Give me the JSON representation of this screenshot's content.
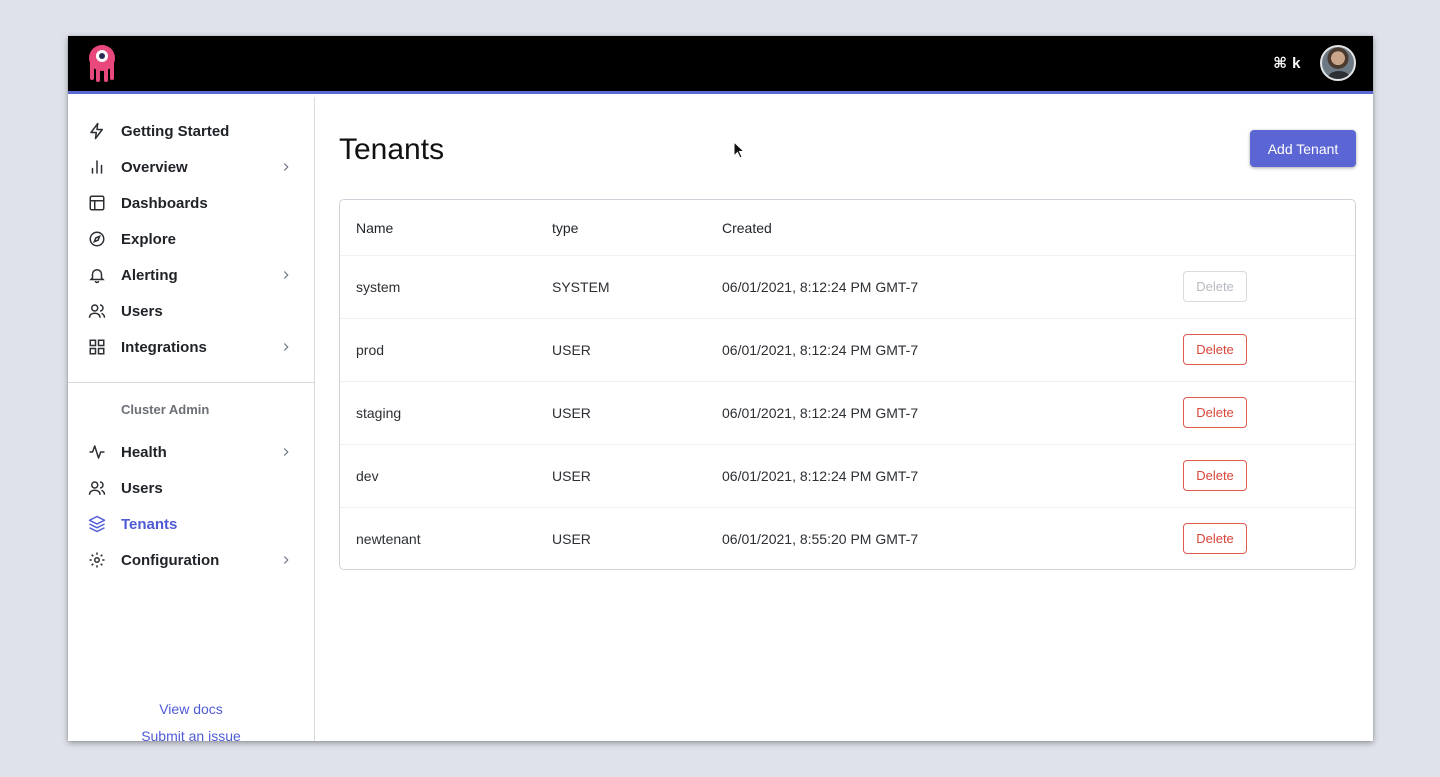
{
  "topbar": {
    "shortcut": "⌘ k",
    "accent_color": "#5b6ad3",
    "logo_icon": "octopus-logo-icon",
    "avatar_icon": "user-avatar"
  },
  "sidebar": {
    "items": [
      {
        "label": "Getting Started",
        "icon": "bolt-icon",
        "chevron": false
      },
      {
        "label": "Overview",
        "icon": "bar-chart-icon",
        "chevron": true
      },
      {
        "label": "Dashboards",
        "icon": "dashboard-icon",
        "chevron": false
      },
      {
        "label": "Explore",
        "icon": "compass-icon",
        "chevron": false
      },
      {
        "label": "Alerting",
        "icon": "bell-icon",
        "chevron": true
      },
      {
        "label": "Users",
        "icon": "users-icon",
        "chevron": false
      },
      {
        "label": "Integrations",
        "icon": "grid-icon",
        "chevron": true
      }
    ],
    "section_title": "Cluster Admin",
    "admin_items": [
      {
        "label": "Health",
        "icon": "activity-icon",
        "chevron": true
      },
      {
        "label": "Users",
        "icon": "users-icon",
        "chevron": false
      },
      {
        "label": "Tenants",
        "icon": "layers-icon",
        "chevron": false,
        "active": true
      },
      {
        "label": "Configuration",
        "icon": "gear-icon",
        "chevron": true
      }
    ],
    "links": {
      "docs": "View docs",
      "issue": "Submit an issue"
    },
    "active_color": "#4f5bd5"
  },
  "main": {
    "title": "Tenants",
    "add_button": "Add Tenant",
    "table": {
      "headers": [
        "Name",
        "type",
        "Created"
      ],
      "rows": [
        {
          "name": "system",
          "type": "SYSTEM",
          "created": "06/01/2021, 8:12:24 PM GMT-7",
          "action": "Delete",
          "disabled": true
        },
        {
          "name": "prod",
          "type": "USER",
          "created": "06/01/2021, 8:12:24 PM GMT-7",
          "action": "Delete",
          "disabled": false
        },
        {
          "name": "staging",
          "type": "USER",
          "created": "06/01/2021, 8:12:24 PM GMT-7",
          "action": "Delete",
          "disabled": false
        },
        {
          "name": "dev",
          "type": "USER",
          "created": "06/01/2021, 8:12:24 PM GMT-7",
          "action": "Delete",
          "disabled": false
        },
        {
          "name": "newtenant",
          "type": "USER",
          "created": "06/01/2021, 8:55:20 PM GMT-7",
          "action": "Delete",
          "disabled": false
        }
      ]
    },
    "button_color": "#5b65d4",
    "danger_color": "#d9463a"
  }
}
